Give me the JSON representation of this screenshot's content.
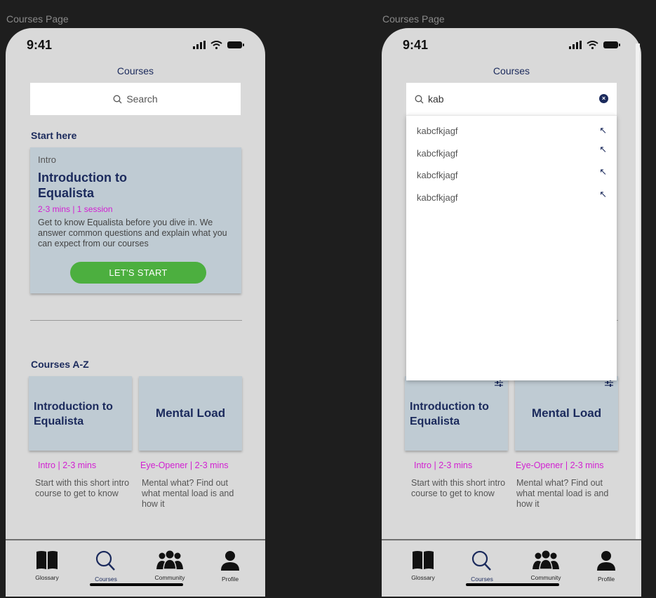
{
  "left_screen": {
    "frame_label": "Courses Page",
    "status_time": "9:41",
    "page_title": "Courses",
    "search_placeholder": "Search",
    "start_here": {
      "heading": "Start here",
      "card_kicker": "Intro",
      "card_title": "Introduction to Equalista",
      "card_meta": "2-3 mins | 1 session",
      "card_description": "Get to know Equalista before you dive in. We answer common questions and explain what you can expect from our courses",
      "cta_label": "LET'S START"
    },
    "courses_heading": "Courses A-Z",
    "courses": [
      {
        "title": "Introduction to Equalista",
        "meta": "Intro | 2-3 mins",
        "description": "Start with this short intro course to get to know"
      },
      {
        "title": "Mental Load",
        "meta": "Eye-Opener | 2-3 mins",
        "description": "Mental what? Find out what  mental load is and how it"
      }
    ],
    "tabs": [
      {
        "label": "Glossary",
        "icon": "book-icon"
      },
      {
        "label": "Courses",
        "icon": "search-icon"
      },
      {
        "label": "Community",
        "icon": "community-icon"
      },
      {
        "label": "Profile",
        "icon": "profile-icon"
      }
    ]
  },
  "right_screen": {
    "frame_label": "Courses Page",
    "status_time": "9:41",
    "page_title": "Courses",
    "search_value": "kab",
    "suggestions": [
      "kabcfkjagf",
      "kabcfkjagf",
      "kabcfkjagf",
      "kabcfkjagf"
    ],
    "courses": [
      {
        "title": "Introduction to Equalista",
        "meta": "Intro | 2-3 mins",
        "description": "Start with this short intro course to get to know"
      },
      {
        "title": "Mental Load",
        "meta": "Eye-Opener | 2-3 mins",
        "description": "Mental what? Find out what  mental load is and how it"
      }
    ],
    "tabs": [
      {
        "label": "Glossary",
        "icon": "book-icon"
      },
      {
        "label": "Courses",
        "icon": "search-icon"
      },
      {
        "label": "Community",
        "icon": "community-icon"
      },
      {
        "label": "Profile",
        "icon": "profile-icon"
      }
    ]
  },
  "colors": {
    "navy": "#1b2a5c",
    "magenta": "#d21fd2",
    "green": "#4caf3f",
    "card": "#bfcbd3",
    "screen": "#d9d9d9"
  }
}
